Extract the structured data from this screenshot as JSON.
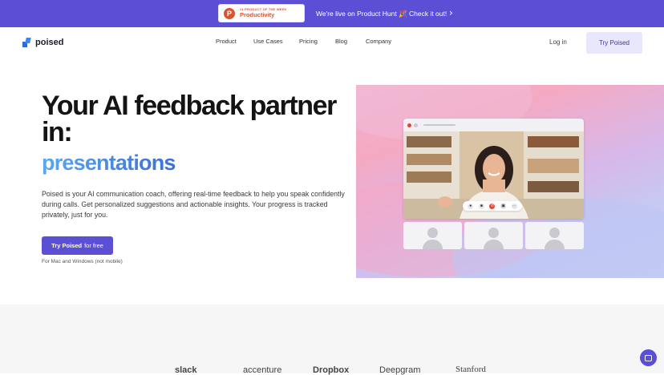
{
  "announcement": {
    "badge_small": "#1 PRODUCT OF THE WEEK",
    "badge_category": "Productivity",
    "badge_logo_letter": "P",
    "text": "We're live on Product Hunt 🎉 Check it out!",
    "chevron": "›"
  },
  "nav": {
    "brand": "poised",
    "links": [
      "Product",
      "Use Cases",
      "Pricing",
      "Blog",
      "Company"
    ],
    "login": "Log in",
    "try": "Try Poised"
  },
  "hero": {
    "title": "Your AI feedback partner in:",
    "title_line1": "Your AI feedback partner",
    "title_line2": "in:",
    "rotating_word": "presentations",
    "description": "Poised is your AI communication coach, offering real-time feedback to help you speak confidently during calls. Get personalized suggestions and actionable insights. Your progress is tracked privately, just for you.",
    "cta_bold": "Try Poised",
    "cta_rest": "for free",
    "cta_note": "For Mac and Windows (not mobile)"
  },
  "logos": [
    "slack",
    "accenture",
    "Dropbox",
    "Deepgram",
    "Stanford"
  ],
  "colors": {
    "accent": "#5b4fd6",
    "highlight": "#3a7fdc",
    "end_call": "#e0453a"
  },
  "icons": {
    "chat": "chat-bubble-icon",
    "call_controls": [
      "mic-icon",
      "camera-icon",
      "end-call-icon",
      "screen-share-icon",
      "more-icon"
    ]
  }
}
